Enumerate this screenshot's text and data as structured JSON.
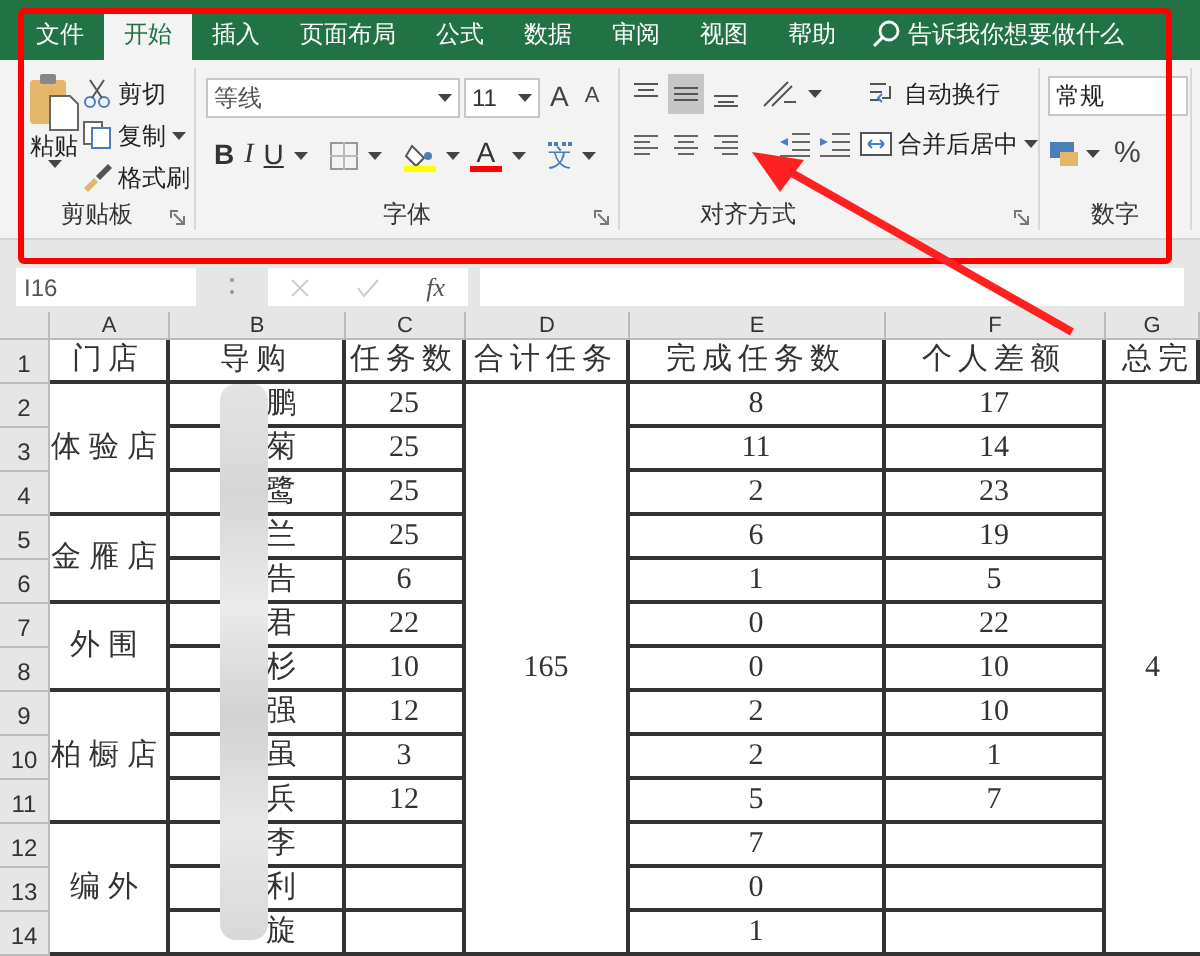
{
  "tabs": [
    {
      "label": "文件",
      "selected": false
    },
    {
      "label": "开始",
      "selected": true
    },
    {
      "label": "插入",
      "selected": false
    },
    {
      "label": "页面布局",
      "selected": false
    },
    {
      "label": "公式",
      "selected": false
    },
    {
      "label": "数据",
      "selected": false
    },
    {
      "label": "审阅",
      "selected": false
    },
    {
      "label": "视图",
      "selected": false
    },
    {
      "label": "帮助",
      "selected": false
    }
  ],
  "tell_me": "告诉我你想要做什么",
  "clipboard": {
    "paste": "粘贴",
    "cut": "剪切",
    "copy": "复制",
    "format_painter": "格式刷",
    "label": "剪贴板"
  },
  "font": {
    "name": "等线",
    "size": "11",
    "grow": "A",
    "shrink": "A",
    "bold": "B",
    "italic": "I",
    "underline": "U",
    "font_color": "A",
    "phonetic": "文",
    "label": "字体"
  },
  "alignment": {
    "vertical": [
      {
        "kind": "top",
        "selected": false
      },
      {
        "kind": "middle",
        "selected": true
      },
      {
        "kind": "bottom",
        "selected": false
      }
    ],
    "wrap": "自动换行",
    "merge": "合并后居中",
    "label": "对齐方式"
  },
  "number": {
    "format": "常规",
    "percent": "%",
    "label": "数字"
  },
  "formula_bar": {
    "name_box": "I16",
    "fx": "fx"
  },
  "sheet": {
    "columns": [
      "A",
      "B",
      "C",
      "D",
      "E",
      "F",
      "G"
    ],
    "row_numbers": [
      "1",
      "2",
      "3",
      "4",
      "5",
      "6",
      "7",
      "8",
      "9",
      "10",
      "11",
      "12",
      "13",
      "14"
    ],
    "headers": [
      "门店",
      "导购",
      "任务数",
      "合计任务",
      "完成任务数",
      "个人差额",
      "总完"
    ],
    "total_tasks": "165",
    "total_done": "4",
    "stores": [
      {
        "name": "体验店",
        "staff": [
          {
            "name": "鹏",
            "tasks": "25",
            "done": "8",
            "gap": "17"
          },
          {
            "name": "菊",
            "tasks": "25",
            "done": "11",
            "gap": "14"
          },
          {
            "name": "鹭",
            "tasks": "25",
            "done": "2",
            "gap": "23"
          }
        ]
      },
      {
        "name": "金雁店",
        "staff": [
          {
            "name": "兰",
            "tasks": "25",
            "done": "6",
            "gap": "19"
          },
          {
            "name": "告",
            "tasks": "6",
            "done": "1",
            "gap": "5"
          }
        ]
      },
      {
        "name": "外围",
        "staff": [
          {
            "name": "君",
            "tasks": "22",
            "done": "0",
            "gap": "22"
          },
          {
            "name": "杉",
            "tasks": "10",
            "done": "0",
            "gap": "10"
          }
        ]
      },
      {
        "name": "柏橱店",
        "staff": [
          {
            "name": "强",
            "tasks": "12",
            "done": "2",
            "gap": "10"
          },
          {
            "name": "虽",
            "tasks": "3",
            "done": "2",
            "gap": "1"
          },
          {
            "name": "兵",
            "tasks": "12",
            "done": "5",
            "gap": "7"
          }
        ]
      },
      {
        "name": "编外",
        "staff": [
          {
            "name": "李",
            "done": "7"
          },
          {
            "name": "利",
            "done": "0"
          },
          {
            "name": "旋",
            "done": "1"
          }
        ]
      }
    ]
  },
  "annotations": [
    {
      "kind": "frame"
    },
    {
      "kind": "arrow"
    }
  ]
}
